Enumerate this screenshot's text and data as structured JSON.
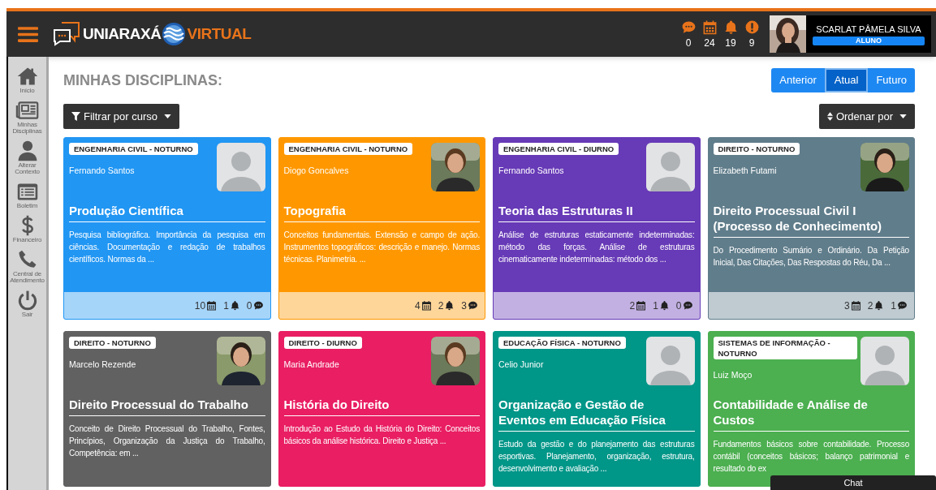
{
  "header": {
    "brand_left": "UNIARAXÁ",
    "brand_right": "VIRTUAL",
    "counters": [
      {
        "kind": "messages",
        "count": "0"
      },
      {
        "kind": "calendar",
        "count": "24"
      },
      {
        "kind": "bell",
        "count": "19"
      },
      {
        "kind": "alert",
        "count": "9"
      }
    ],
    "user": {
      "name": "SCARLAT PÂMELA SILVA",
      "role": "ALUNO"
    }
  },
  "sidebar": {
    "items": [
      {
        "kind": "home",
        "label": "Início"
      },
      {
        "kind": "courses",
        "label": "Minhas Disciplinas"
      },
      {
        "kind": "person",
        "label": "Alterar Contexto"
      },
      {
        "kind": "report",
        "label": "Boletim"
      },
      {
        "kind": "money",
        "label": "Financeiro"
      },
      {
        "kind": "phone",
        "label": "Central de Atendimento"
      },
      {
        "kind": "power",
        "label": "Sair"
      }
    ]
  },
  "page_title": "MINHAS DISCIPLINAS:",
  "period_tabs": [
    {
      "label": "Anterior",
      "selected": false
    },
    {
      "label": "Atual",
      "selected": true
    },
    {
      "label": "Futuro",
      "selected": false
    }
  ],
  "filter_button": "Filtrar por curso",
  "sort_button": "Ordenar por",
  "courses": [
    {
      "program": "ENGENHARIA CIVIL - NOTURNO",
      "teacher": "Fernando Santos",
      "photo": false,
      "title": "Produção Científica",
      "description": "Pesquisa bibliográfica. Importância da pesquisa em ciências. Documentação e redação de trabalhos científicos. Normas da ...",
      "color": "#2196f3",
      "footer": {
        "events": "10",
        "notices": "1",
        "messages": "0"
      }
    },
    {
      "program": "ENGENHARIA CIVIL - NOTURNO",
      "teacher": "Diogo Goncalves",
      "photo": true,
      "title": "Topografia",
      "description": "Conceitos fundamentais. Extensão e campo de ação. Instrumentos topográficos: descrição e manejo. Normas técnicas. Planimetria. ...",
      "color": "#ff9800",
      "footer": {
        "events": "4",
        "notices": "2",
        "messages": "3"
      }
    },
    {
      "program": "ENGENHARIA CIVIL - DIURNO",
      "teacher": "Fernando Santos",
      "photo": false,
      "title": "Teoria das Estruturas II",
      "description": "Análise de estruturas estaticamente indeterminadas: método das forças. Análise de estruturas cinematicamente indeterminadas: método dos ...",
      "color": "#673ab7",
      "footer": {
        "events": "2",
        "notices": "1",
        "messages": "0"
      }
    },
    {
      "program": "DIREITO - NOTURNO",
      "teacher": "Elizabeth Futami",
      "photo": true,
      "title": "Direito Processual Civil I (Processo de Conhecimento)",
      "description": "Do Procedimento Sumário e Ordinário. Da Petição Inicial, Das Citações, Das Respostas do Réu, Da ...",
      "color": "#607d8b",
      "footer": {
        "events": "3",
        "notices": "2",
        "messages": "1"
      }
    },
    {
      "program": "DIREITO - NOTURNO",
      "teacher": "Marcelo Rezende",
      "photo": true,
      "title": "Direito Processual do Trabalho",
      "description": "Conceito de Direito Processual do Trabalho, Fontes, Princípios, Organização da Justiça do Trabalho, Competência: em ...",
      "color": "#616161"
    },
    {
      "program": "DIREITO - DIURNO",
      "teacher": "Maria Andrade",
      "photo": true,
      "title": "História do Direito",
      "description": "Introdução ao Estudo da História do Direito: Conceitos básicos da análise histórica. Direito e Justiça ...",
      "color": "#e91e63"
    },
    {
      "program": "EDUCAÇÃO FÍSICA - NOTURNO",
      "teacher": "Celio Junior",
      "photo": false,
      "title": "Organização e Gestão de Eventos em Educação Física",
      "description": "Estudo da gestão e do planejamento das estruturas esportivas. Planejamento, organização, estrutura, desenvolvimento e avaliação ...",
      "color": "#009688"
    },
    {
      "program": "SISTEMAS DE INFORMAÇÃO - NOTURNO",
      "teacher": "Luiz Moço",
      "photo": false,
      "title": "Contabilidade e Análise de Custos",
      "description": "Fundamentos básicos sobre contabilidade. Processo contábil (conceitos básicos; balanço patrimonial e resultado do ex",
      "color": "#4caf50"
    }
  ],
  "chat": {
    "label": "Chat"
  }
}
